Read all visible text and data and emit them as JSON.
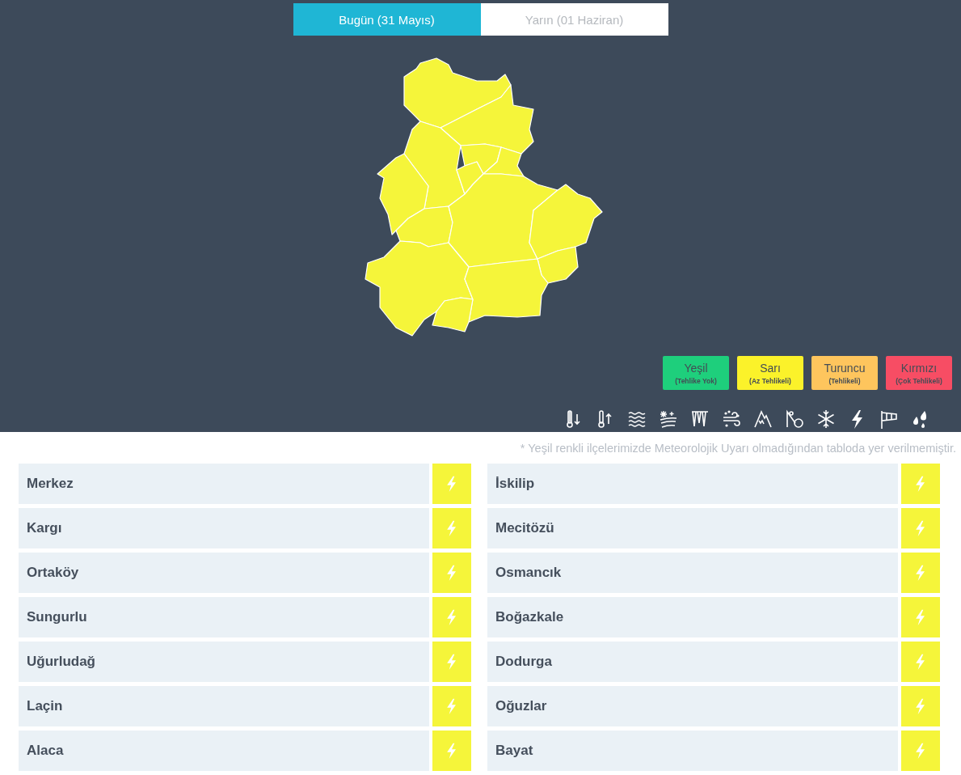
{
  "tabs": [
    {
      "label": "Bugün (31 Mayıs)",
      "selected": true
    },
    {
      "label": "Yarın (01 Haziran)",
      "selected": false
    }
  ],
  "legend": [
    {
      "label": "Yeşil",
      "note": "(Tehlike Yok)",
      "color": "#1ecf7c"
    },
    {
      "label": "Sarı",
      "note": "(Az Tehlikeli)",
      "color": "#fbf22a"
    },
    {
      "label": "Turuncu",
      "note": "(Tehlikeli)",
      "color": "#fec55d"
    },
    {
      "label": "Kırmızı",
      "note": "(Çok Tehlikeli)",
      "color": "#f74d64"
    }
  ],
  "footnote": "* Yeşil renkli ilçelerimizde Meteorolojik Uyarı olmadığından tabloda yer verilmemiştir.",
  "districts": [
    {
      "name": "Merkez",
      "color": "#f5f53a",
      "kind": "thunderstorm"
    },
    {
      "name": "Kargı",
      "color": "#f5f53a",
      "kind": "thunderstorm"
    },
    {
      "name": "Ortaköy",
      "color": "#f5f53a",
      "kind": "thunderstorm"
    },
    {
      "name": "Sungurlu",
      "color": "#f5f53a",
      "kind": "thunderstorm"
    },
    {
      "name": "Uğurludağ",
      "color": "#f5f53a",
      "kind": "thunderstorm"
    },
    {
      "name": "Laçin",
      "color": "#f5f53a",
      "kind": "thunderstorm"
    },
    {
      "name": "Alaca",
      "color": "#f5f53a",
      "kind": "thunderstorm"
    },
    {
      "name": "İskilip",
      "color": "#f5f53a",
      "kind": "thunderstorm"
    },
    {
      "name": "Mecitözü",
      "color": "#f5f53a",
      "kind": "thunderstorm"
    },
    {
      "name": "Osmancık",
      "color": "#f5f53a",
      "kind": "thunderstorm"
    },
    {
      "name": "Boğazkale",
      "color": "#f5f53a",
      "kind": "thunderstorm"
    },
    {
      "name": "Dodurga",
      "color": "#f5f53a",
      "kind": "thunderstorm"
    },
    {
      "name": "Oğuzlar",
      "color": "#f5f53a",
      "kind": "thunderstorm"
    },
    {
      "name": "Bayat",
      "color": "#f5f53a",
      "kind": "thunderstorm"
    }
  ]
}
